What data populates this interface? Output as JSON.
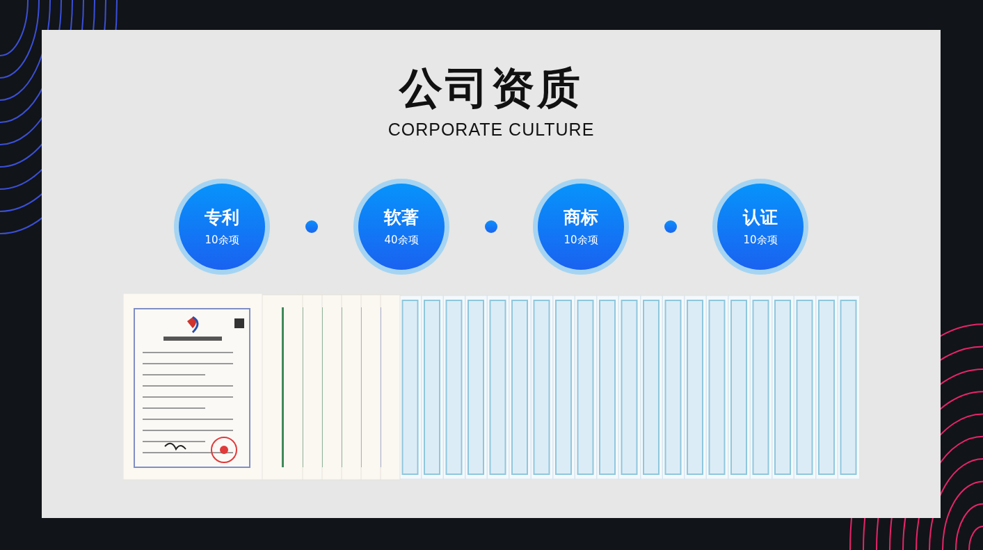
{
  "heading": {
    "title": "公司资质",
    "subtitle": "CORPORATE CULTURE"
  },
  "stats": [
    {
      "label": "专利",
      "count": "10余项"
    },
    {
      "label": "软著",
      "count": "40余项"
    },
    {
      "label": "商标",
      "count": "10余项"
    },
    {
      "label": "认证",
      "count": "10余项"
    }
  ]
}
